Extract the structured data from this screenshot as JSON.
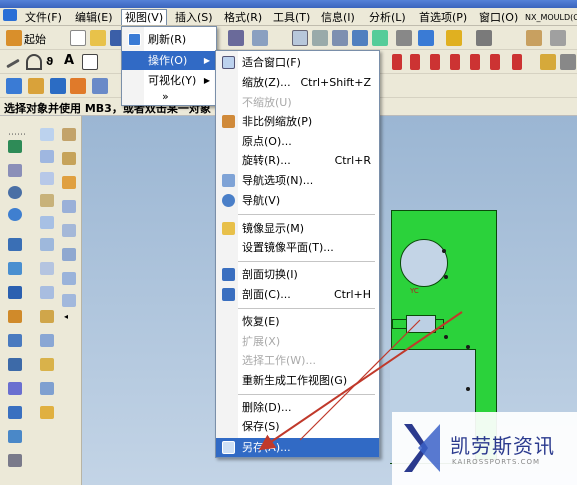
{
  "menubar": {
    "items": [
      {
        "label": "文件(F)"
      },
      {
        "label": "编辑(E)"
      },
      {
        "label": "视图(V)"
      },
      {
        "label": "插入(S)"
      },
      {
        "label": "格式(R)"
      },
      {
        "label": "工具(T)"
      },
      {
        "label": "信息(I)"
      },
      {
        "label": "分析(L)"
      },
      {
        "label": "首选项(P)"
      },
      {
        "label": "窗口(O)"
      },
      {
        "label": "NX_MOULD(O)"
      }
    ]
  },
  "toolbar": {
    "start_label": "起始"
  },
  "status": {
    "prompt": "选择对象并使用 MB3，或者双击某一对象"
  },
  "view_menu": {
    "items": [
      {
        "label": "刷新(R)"
      },
      {
        "label": "操作(O)"
      },
      {
        "label": "可视化(Y)"
      },
      {
        "label": "»"
      }
    ]
  },
  "operation_menu": {
    "items": [
      {
        "label": "适合窗口(F)",
        "shortcut": ""
      },
      {
        "label": "缩放(Z)...",
        "shortcut": "Ctrl+Shift+Z"
      },
      {
        "label": "不缩放(U)",
        "shortcut": ""
      },
      {
        "label": "非比例缩放(P)",
        "shortcut": ""
      },
      {
        "label": "原点(O)...",
        "shortcut": ""
      },
      {
        "label": "旋转(R)...",
        "shortcut": "Ctrl+R"
      },
      {
        "label": "导航选项(N)...",
        "shortcut": ""
      },
      {
        "label": "导航(V)",
        "shortcut": ""
      },
      {
        "label": "镜像显示(M)",
        "shortcut": ""
      },
      {
        "label": "设置镜像平面(T)...",
        "shortcut": ""
      },
      {
        "label": "剖面切换(I)",
        "shortcut": ""
      },
      {
        "label": "剖面(C)...",
        "shortcut": "Ctrl+H"
      },
      {
        "label": "恢复(E)",
        "shortcut": ""
      },
      {
        "label": "扩展(X)",
        "shortcut": ""
      },
      {
        "label": "选择工作(W)...",
        "shortcut": ""
      },
      {
        "label": "重新生成工作视图(G)",
        "shortcut": ""
      },
      {
        "label": "删除(D)...",
        "shortcut": ""
      },
      {
        "label": "保存(S)",
        "shortcut": ""
      },
      {
        "label": "另存(A)...",
        "shortcut": ""
      }
    ]
  },
  "canvas": {
    "axis_label": "YC"
  },
  "watermark": {
    "title": "凯劳斯资讯",
    "subtitle": "KAIROSSPORTS.COM"
  },
  "colors": {
    "highlight": "#316ac5",
    "part": "#2bd23b",
    "arrow": "#c0392b",
    "watermark": "#2b3a8e"
  }
}
